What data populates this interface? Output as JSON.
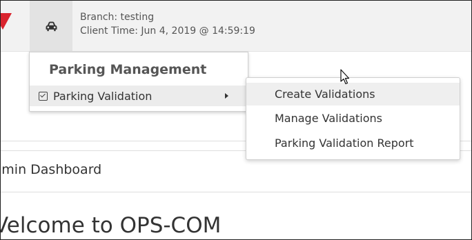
{
  "header": {
    "branch": "Branch: testing",
    "client_time": "Client Time: Jun 4, 2019 @ 14:59:19",
    "car_icon": "car-icon",
    "logo_color": "#d9232d"
  },
  "menu": {
    "title": "Parking Management",
    "item_label": "Parking Validation",
    "item_icon": "checkbox-icon",
    "submenu_indicator": "caret-right-icon"
  },
  "submenu": {
    "items": [
      {
        "label": "Create Validations",
        "active": true
      },
      {
        "label": "Manage Validations",
        "active": false
      },
      {
        "label": "Parking Validation Report",
        "active": false
      }
    ]
  },
  "page": {
    "dashboard_title": "lmin Dashboard",
    "welcome": "Velcome to OPS-COM"
  }
}
